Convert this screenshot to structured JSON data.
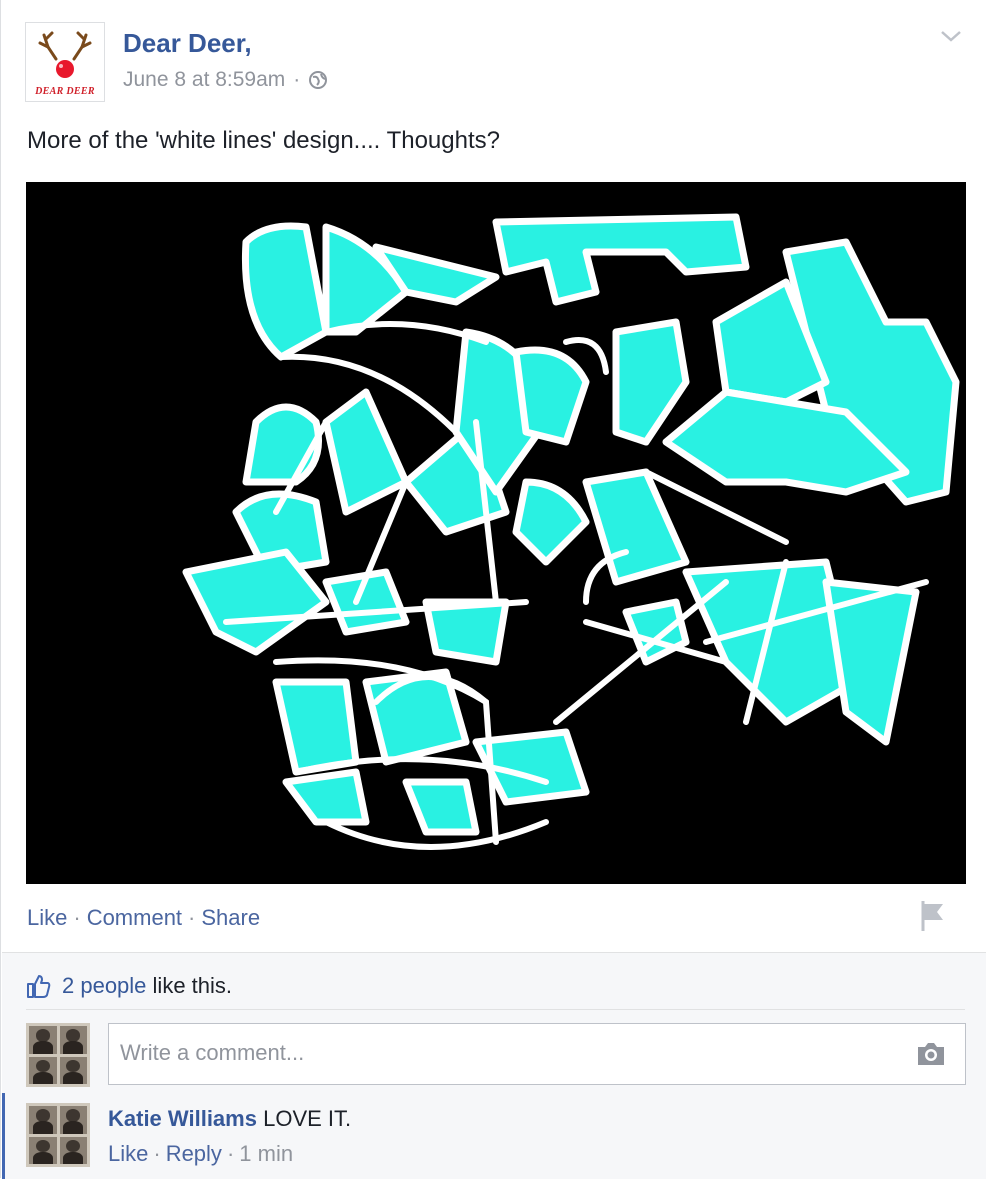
{
  "post": {
    "page_name": "Dear Deer,",
    "avatar_text": "DEAR DEER",
    "timestamp": "June 8 at 8:59am",
    "privacy_separator": "·",
    "text": "More of the 'white lines' design.... Thoughts?",
    "photo_icon": "white-lines-artwork",
    "colors": {
      "accent": "#29f1e2",
      "background": "#000000",
      "lines": "#ffffff"
    }
  },
  "actions": {
    "like": "Like",
    "comment": "Comment",
    "share": "Share",
    "sep": "·"
  },
  "ufi": {
    "like_count": "2 people",
    "like_suffix": "like this.",
    "comment_placeholder": "Write a comment..."
  },
  "comments": [
    {
      "author": "Katie Williams",
      "text": "LOVE IT.",
      "like": "Like",
      "reply": "Reply",
      "time": "1 min",
      "sep": "·"
    }
  ],
  "icons": [
    "chevron-down-icon",
    "globe-icon",
    "flag-icon",
    "thumbs-up-icon",
    "camera-icon"
  ],
  "theme": {
    "link": "#365899",
    "muted": "#90949c",
    "action": "#4b66a0"
  }
}
